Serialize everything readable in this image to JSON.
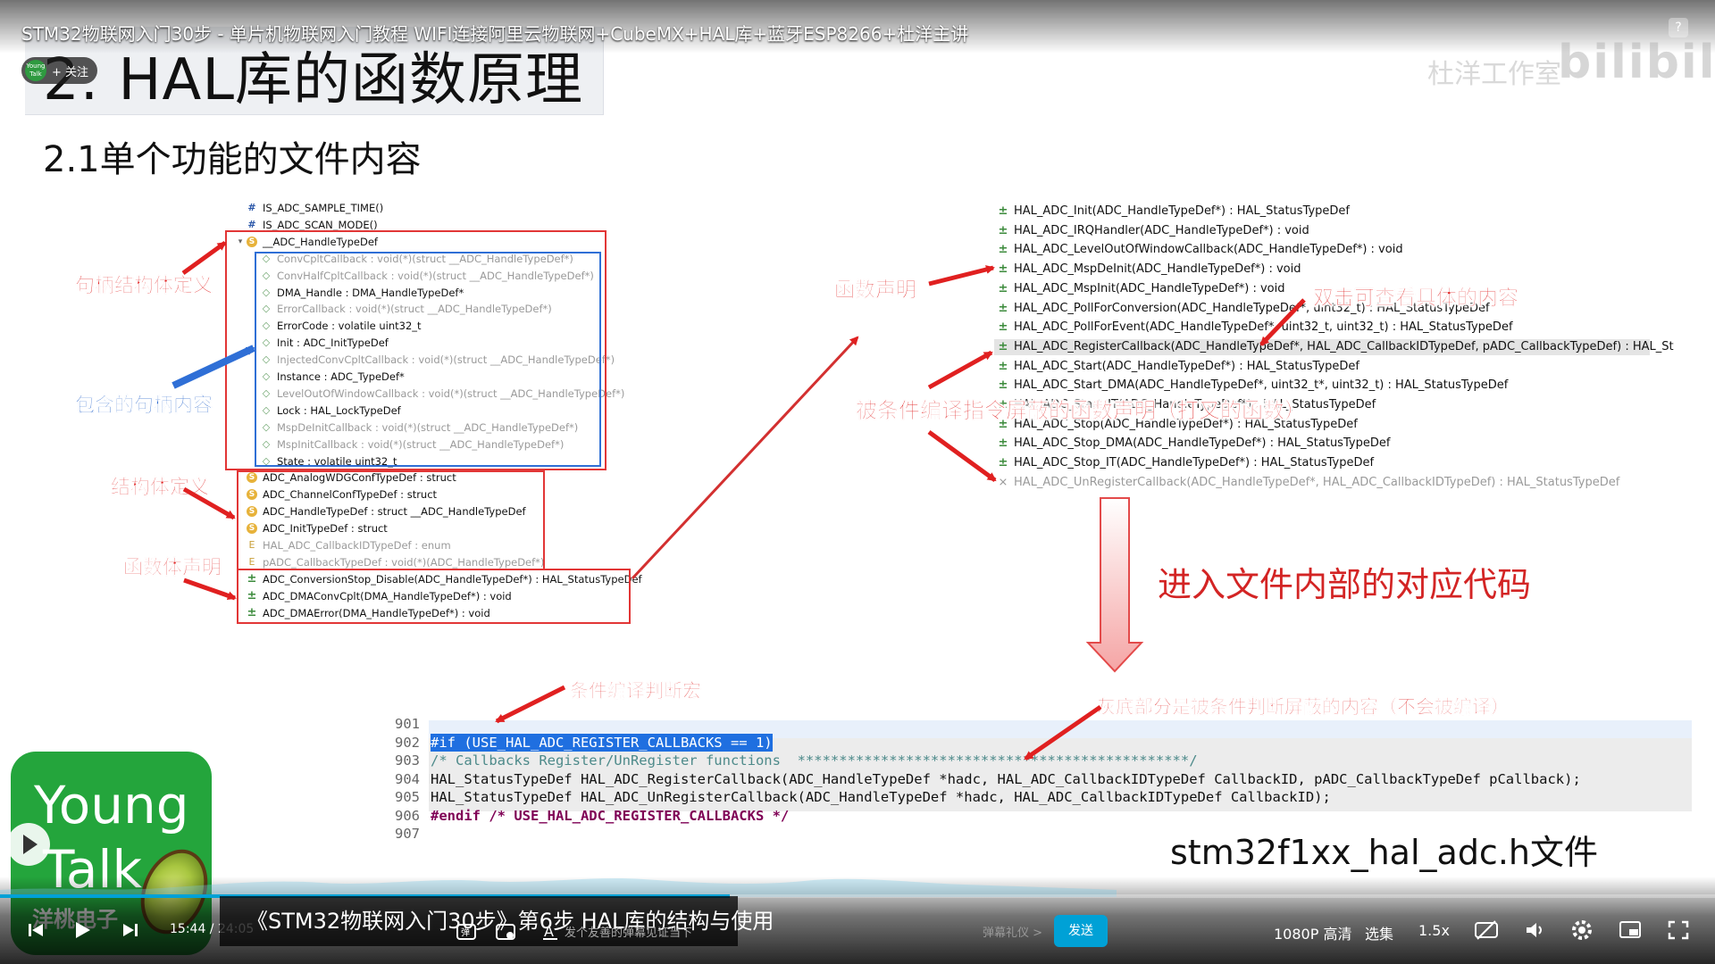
{
  "slide": {
    "title": "2. HAL库的函数原理",
    "subtitle": "2.1单个功能的文件内容",
    "outline_left": [
      {
        "icon": "hash",
        "text": "IS_ADC_SAMPLE_TIME()",
        "gray": false
      },
      {
        "icon": "hash",
        "text": "IS_ADC_SCAN_MODE()",
        "gray": false
      },
      {
        "icon": "struct-open",
        "text": "__ADC_HandleTypeDef",
        "gray": false
      },
      {
        "icon": "field",
        "text": "ConvCpltCallback : void(*)(struct __ADC_HandleTypeDef*)",
        "gray": true
      },
      {
        "icon": "field",
        "text": "ConvHalfCpltCallback : void(*)(struct __ADC_HandleTypeDef*)",
        "gray": true
      },
      {
        "icon": "field",
        "text": "DMA_Handle : DMA_HandleTypeDef*",
        "gray": false
      },
      {
        "icon": "field",
        "text": "ErrorCallback : void(*)(struct __ADC_HandleTypeDef*)",
        "gray": true
      },
      {
        "icon": "field",
        "text": "ErrorCode : volatile uint32_t",
        "gray": false
      },
      {
        "icon": "field",
        "text": "Init : ADC_InitTypeDef",
        "gray": false
      },
      {
        "icon": "field",
        "text": "InjectedConvCpltCallback : void(*)(struct __ADC_HandleTypeDef*)",
        "gray": true
      },
      {
        "icon": "field",
        "text": "Instance : ADC_TypeDef*",
        "gray": false
      },
      {
        "icon": "field",
        "text": "LevelOutOfWindowCallback : void(*)(struct __ADC_HandleTypeDef*)",
        "gray": true
      },
      {
        "icon": "field",
        "text": "Lock : HAL_LockTypeDef",
        "gray": false
      },
      {
        "icon": "field",
        "text": "MspDeInitCallback : void(*)(struct __ADC_HandleTypeDef*)",
        "gray": true
      },
      {
        "icon": "field",
        "text": "MspInitCallback : void(*)(struct __ADC_HandleTypeDef*)",
        "gray": true
      },
      {
        "icon": "field",
        "text": "State : volatile uint32_t",
        "gray": false
      },
      {
        "icon": "struct",
        "text": "ADC_AnalogWDGConfTypeDef : struct",
        "gray": false
      },
      {
        "icon": "struct",
        "text": "ADC_ChannelConfTypeDef : struct",
        "gray": false
      },
      {
        "icon": "struct",
        "text": "ADC_HandleTypeDef : struct __ADC_HandleTypeDef",
        "gray": false
      },
      {
        "icon": "struct",
        "text": "ADC_InitTypeDef : struct",
        "gray": false
      },
      {
        "icon": "enum",
        "text": "HAL_ADC_CallbackIDTypeDef : enum",
        "gray": true
      },
      {
        "icon": "enum",
        "text": "pADC_CallbackTypeDef : void(*)(ADC_HandleTypeDef*)",
        "gray": true
      },
      {
        "icon": "func",
        "text": "ADC_ConversionStop_Disable(ADC_HandleTypeDef*) : HAL_StatusTypeDef",
        "gray": false
      },
      {
        "icon": "func",
        "text": "ADC_DMAConvCplt(DMA_HandleTypeDef*) : void",
        "gray": false
      },
      {
        "icon": "func",
        "text": "ADC_DMAError(DMA_HandleTypeDef*) : void",
        "gray": false
      }
    ],
    "outline_right": [
      {
        "text": "HAL_ADC_Init(ADC_HandleTypeDef*) : HAL_StatusTypeDef",
        "gray": false,
        "selected": false
      },
      {
        "text": "HAL_ADC_IRQHandler(ADC_HandleTypeDef*) : void",
        "gray": false,
        "selected": false
      },
      {
        "text": "HAL_ADC_LevelOutOfWindowCallback(ADC_HandleTypeDef*) : void",
        "gray": false,
        "selected": false
      },
      {
        "text": "HAL_ADC_MspDeInit(ADC_HandleTypeDef*) : void",
        "gray": false,
        "selected": false
      },
      {
        "text": "HAL_ADC_MspInit(ADC_HandleTypeDef*) : void",
        "gray": false,
        "selected": false
      },
      {
        "text": "HAL_ADC_PollForConversion(ADC_HandleTypeDef*, uint32_t) : HAL_StatusTypeDef",
        "gray": false,
        "selected": false
      },
      {
        "text": "HAL_ADC_PollForEvent(ADC_HandleTypeDef*, uint32_t, uint32_t) : HAL_StatusTypeDef",
        "gray": false,
        "selected": false
      },
      {
        "text": "HAL_ADC_RegisterCallback(ADC_HandleTypeDef*, HAL_ADC_CallbackIDTypeDef, pADC_CallbackTypeDef) : HAL_St",
        "gray": false,
        "selected": true
      },
      {
        "text": "HAL_ADC_Start(ADC_HandleTypeDef*) : HAL_StatusTypeDef",
        "gray": false,
        "selected": false
      },
      {
        "text": "HAL_ADC_Start_DMA(ADC_HandleTypeDef*, uint32_t*, uint32_t) : HAL_StatusTypeDef",
        "gray": false,
        "selected": false
      },
      {
        "text": "HAL_ADC_Start_IT(ADC_HandleTypeDef*) : HAL_StatusTypeDef",
        "gray": false,
        "selected": false
      },
      {
        "text": "HAL_ADC_Stop(ADC_HandleTypeDef*) : HAL_StatusTypeDef",
        "gray": false,
        "selected": false
      },
      {
        "text": "HAL_ADC_Stop_DMA(ADC_HandleTypeDef*) : HAL_StatusTypeDef",
        "gray": false,
        "selected": false
      },
      {
        "text": "HAL_ADC_Stop_IT(ADC_HandleTypeDef*) : HAL_StatusTypeDef",
        "gray": false,
        "selected": false
      },
      {
        "text": "HAL_ADC_UnRegisterCallback(ADC_HandleTypeDef*, HAL_ADC_CallbackIDTypeDef) : HAL_StatusTypeDef",
        "gray": true,
        "selected": false
      }
    ],
    "annotations": {
      "handle_struct_def": "句柄结构体定义",
      "included_handle_content": "包含的句柄内容",
      "struct_def": "结构体定义",
      "func_body_decl": "函数体声明",
      "func_decl": "函数声明",
      "double_click": "双击可查看具体的内容",
      "masked_decl": "被条件编译指令屏蔽的函数声明（打叉的函数）",
      "enter_file": "进入文件内部的对应代码",
      "cond_macro": "条件编译判断宏",
      "gray_note": "灰底部分是被条件判断屏蔽的内容（不会被编译）",
      "file_name": "stm32f1xx_hal_adc.h文件"
    },
    "code_lines": [
      {
        "num": "901",
        "kind": "blank",
        "text": ""
      },
      {
        "num": "902",
        "kind": "if",
        "text": "#if (USE_HAL_ADC_REGISTER_CALLBACKS == 1)"
      },
      {
        "num": "903",
        "kind": "comment",
        "text": "/* Callbacks Register/UnRegister functions  ***********************************************/"
      },
      {
        "num": "904",
        "kind": "code",
        "text": "HAL_StatusTypeDef HAL_ADC_RegisterCallback(ADC_HandleTypeDef *hadc, HAL_ADC_CallbackIDTypeDef CallbackID, pADC_CallbackTypeDef pCallback);"
      },
      {
        "num": "905",
        "kind": "code",
        "text": "HAL_StatusTypeDef HAL_ADC_UnRegisterCallback(ADC_HandleTypeDef *hadc, HAL_ADC_CallbackIDTypeDef CallbackID);"
      },
      {
        "num": "906",
        "kind": "endif",
        "text": "#endif /* USE_HAL_ADC_REGISTER_CALLBACKS */"
      },
      {
        "num": "907",
        "kind": "blank",
        "text": ""
      }
    ],
    "logo": {
      "line1": "Young",
      "line2": "Talk",
      "line3": "洋桃电子"
    }
  },
  "player": {
    "video_title": "STM32物联网入门30步 - 单片机物联网入门教程 WIFI连接阿里云物联网+CubeMX+HAL库+蓝牙ESP8266+杜洋主讲",
    "uploader_avatar_text": "Young Talk",
    "follow_label": "+ 关注",
    "help_label": "?",
    "watermark_site": "bilibili",
    "watermark_user": "杜洋工作室",
    "current_time": "15:44",
    "total_time": "24:05",
    "progress": 0.6533,
    "caption": "《STM32物联网入门30步》第6步 HAL库的结构与使用",
    "danmu_placeholder": "发个友善的弹幕见证当下",
    "danmu_gift": "弹幕礼仪 >",
    "send_label": "发送",
    "quality": "1080P 高清",
    "episodes": "选集",
    "speed": "1.5x",
    "colors": {
      "accent": "#00a1d6",
      "annotation_red": "#e02020",
      "annotation_blue": "#1f5fc9",
      "logo_green": "#24a53c"
    }
  }
}
